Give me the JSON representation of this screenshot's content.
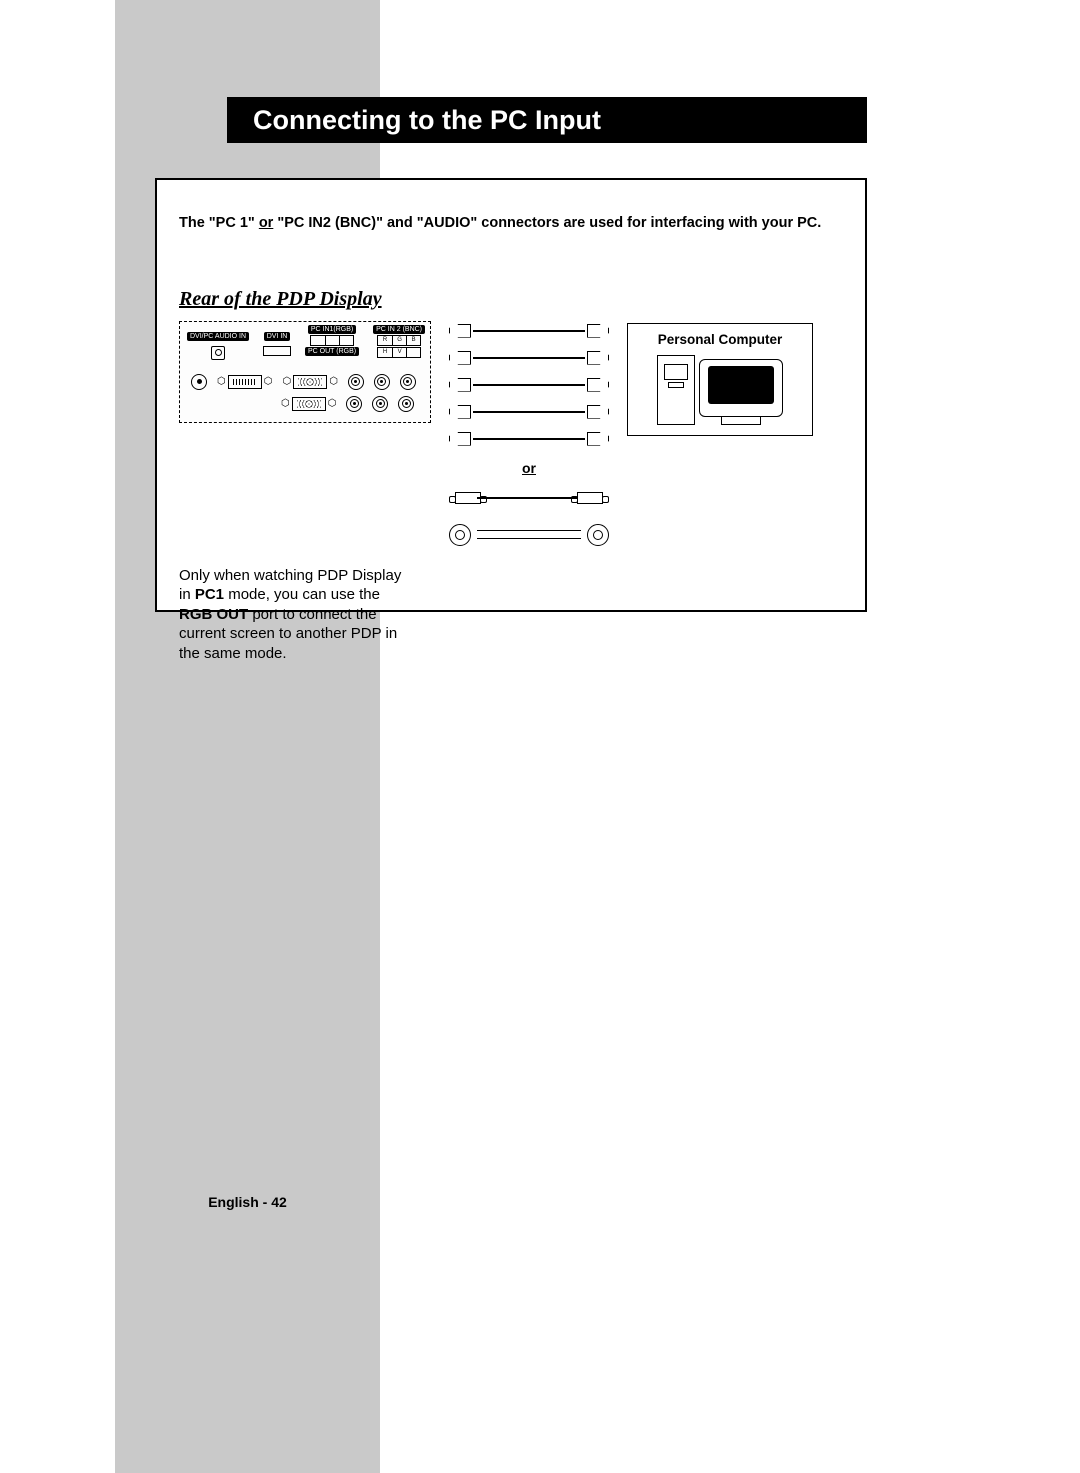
{
  "title": "Connecting to the PC Input",
  "intro_pre": "The \"PC 1\" ",
  "intro_or": "or",
  "intro_post": " \"PC IN2 (BNC)\" and \"AUDIO\" connectors are used for interfacing with your PC.",
  "subtitle": "Rear of the PDP Display",
  "panel": {
    "audio_in": "DVI/PC\nAUDIO IN",
    "dvi_in": "DVI IN",
    "pc_in1": "PC IN1(RGB)",
    "pc_in2": "PC IN 2 (BNC)",
    "pc_out": "PC OUT (RGB)",
    "bnc_labels_top": [
      "R",
      "G",
      "B"
    ],
    "bnc_labels_bot": [
      "H",
      "V",
      ""
    ]
  },
  "or_label": "or",
  "pc_box_title": "Personal Computer",
  "note": {
    "t1": "Only when watching PDP Display in ",
    "b1": "PC1",
    "t2": " mode, you can use the ",
    "b2": "RGB OUT",
    "t3": " port to connect the current screen to another PDP in the same mode."
  },
  "footer": "English - 42"
}
